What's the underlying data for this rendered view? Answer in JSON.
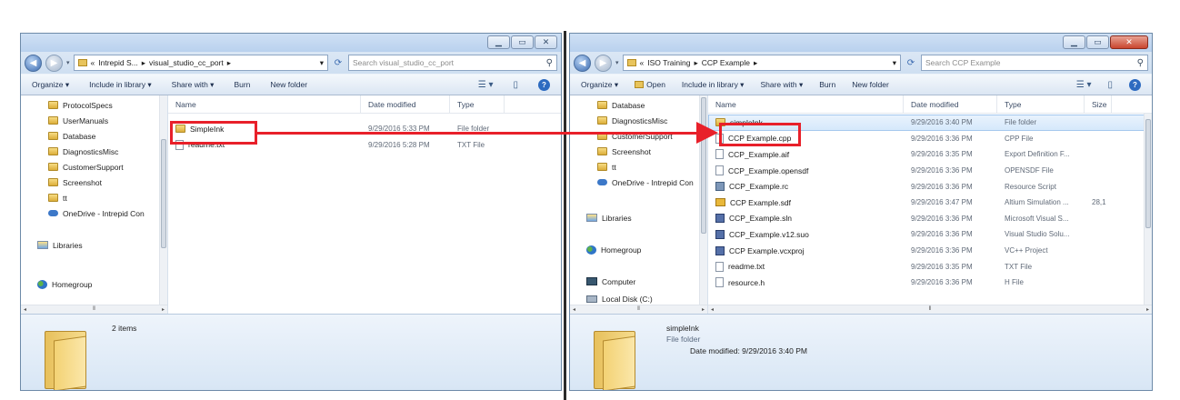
{
  "left": {
    "address": [
      "Intrepid S...",
      "visual_studio_cc_port"
    ],
    "search_placeholder": "Search visual_studio_cc_port",
    "toolbar": {
      "organize": "Organize ▾",
      "include": "Include in library ▾",
      "share": "Share with ▾",
      "burn": "Burn",
      "newfolder": "New folder"
    },
    "nav": [
      {
        "label": "ProtocolSpecs",
        "icon": "folder-icon"
      },
      {
        "label": "UserManuals",
        "icon": "folder-icon"
      },
      {
        "label": "Database",
        "icon": "folder-icon"
      },
      {
        "label": "DiagnosticsMisc",
        "icon": "folder-icon"
      },
      {
        "label": "CustomerSupport",
        "icon": "folder-icon"
      },
      {
        "label": "Screenshot",
        "icon": "folder-icon"
      },
      {
        "label": "tt",
        "icon": "folder-icon"
      },
      {
        "label": "OneDrive - Intrepid Con",
        "icon": "cloud-icon"
      }
    ],
    "nav_groups": [
      {
        "label": "Libraries",
        "icon": "libraries-icon"
      },
      {
        "label": "Homegroup",
        "icon": "homegroup-icon"
      }
    ],
    "columns": [
      "Name",
      "Date modified",
      "Type"
    ],
    "files": [
      {
        "name": "SimpleInk",
        "date": "9/29/2016 5:33 PM",
        "type": "File folder",
        "icon": "folder-icon"
      },
      {
        "name": "readme.txt",
        "date": "9/29/2016 5:28 PM",
        "type": "TXT File",
        "icon": "text-file-icon"
      }
    ],
    "details": {
      "count": "2 items"
    }
  },
  "right": {
    "address": [
      "ISO Training",
      "CCP Example"
    ],
    "search_placeholder": "Search CCP Example",
    "toolbar": {
      "organize": "Organize ▾",
      "open": "Open",
      "include": "Include in library ▾",
      "share": "Share with ▾",
      "burn": "Burn",
      "newfolder": "New folder"
    },
    "nav": [
      {
        "label": "Database",
        "icon": "folder-icon"
      },
      {
        "label": "DiagnosticsMisc",
        "icon": "folder-icon"
      },
      {
        "label": "CustomerSupport",
        "icon": "folder-icon"
      },
      {
        "label": "Screenshot",
        "icon": "folder-icon"
      },
      {
        "label": "tt",
        "icon": "folder-icon"
      },
      {
        "label": "OneDrive - Intrepid Con",
        "icon": "cloud-icon"
      }
    ],
    "nav_groups": [
      {
        "label": "Libraries",
        "icon": "libraries-icon"
      },
      {
        "label": "Homegroup",
        "icon": "homegroup-icon"
      },
      {
        "label": "Computer",
        "icon": "computer-icon"
      },
      {
        "label": "Local Disk (C:)",
        "icon": "disk-icon"
      }
    ],
    "columns": [
      "Name",
      "Date modified",
      "Type",
      "Size"
    ],
    "files": [
      {
        "name": "simpleInk",
        "date": "9/29/2016 3:40 PM",
        "type": "File folder",
        "size": "",
        "icon": "folder-icon"
      },
      {
        "name": "CCP Example.cpp",
        "date": "9/29/2016 3:36 PM",
        "type": "CPP File",
        "size": "",
        "icon": "text-file-icon"
      },
      {
        "name": "CCP_Example.aif",
        "date": "9/29/2016 3:35 PM",
        "type": "Export Definition F...",
        "size": "",
        "icon": "text-file-icon"
      },
      {
        "name": "CCP_Example.opensdf",
        "date": "9/29/2016 3:36 PM",
        "type": "OPENSDF File",
        "size": "",
        "icon": "text-file-icon"
      },
      {
        "name": "CCP_Example.rc",
        "date": "9/29/2016 3:36 PM",
        "type": "Resource Script",
        "size": "",
        "icon": "gear-file-icon"
      },
      {
        "name": "CCP Example.sdf",
        "date": "9/29/2016 3:47 PM",
        "type": "Altium Simulation ...",
        "size": "28,1",
        "icon": "yellow-file-icon"
      },
      {
        "name": "CCP_Example.sln",
        "date": "9/29/2016 3:36 PM",
        "type": "Microsoft Visual S...",
        "size": "",
        "icon": "solution-icon"
      },
      {
        "name": "CCP_Example.v12.suo",
        "date": "9/29/2016 3:36 PM",
        "type": "Visual Studio Solu...",
        "size": "",
        "icon": "suo-file-icon"
      },
      {
        "name": "CCP Example.vcxproj",
        "date": "9/29/2016 3:36 PM",
        "type": "VC++ Project",
        "size": "",
        "icon": "project-file-icon"
      },
      {
        "name": "readme.txt",
        "date": "9/29/2016 3:35 PM",
        "type": "TXT File",
        "size": "",
        "icon": "text-file-icon"
      },
      {
        "name": "resource.h",
        "date": "9/29/2016 3:36 PM",
        "type": "H File",
        "size": "",
        "icon": "text-file-icon"
      }
    ],
    "details": {
      "name": "simpleInk",
      "type": "File folder",
      "modified": "Date modified: 9/29/2016 3:40 PM"
    }
  },
  "colors": {
    "highlight": "#e8202a",
    "selection": "#d4e8fb"
  }
}
